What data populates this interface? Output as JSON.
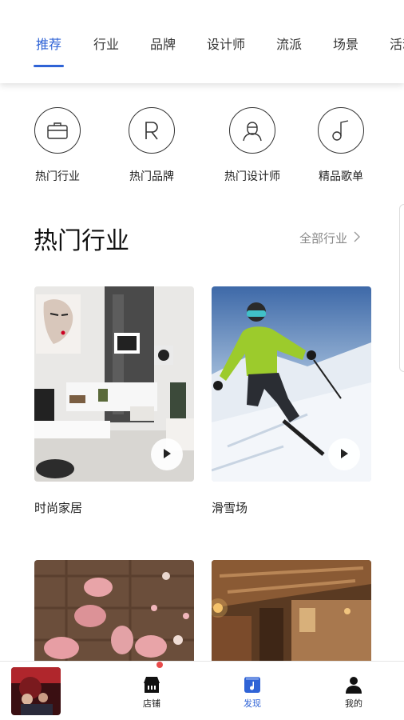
{
  "tabs": [
    {
      "label": "推荐",
      "active": true
    },
    {
      "label": "行业",
      "active": false
    },
    {
      "label": "品牌",
      "active": false
    },
    {
      "label": "设计师",
      "active": false
    },
    {
      "label": "流派",
      "active": false
    },
    {
      "label": "场景",
      "active": false
    },
    {
      "label": "活动",
      "active": false
    }
  ],
  "categories": [
    {
      "label": "热门行业",
      "icon": "briefcase-icon"
    },
    {
      "label": "热门品牌",
      "icon": "brand-r-icon"
    },
    {
      "label": "热门设计师",
      "icon": "designer-icon"
    },
    {
      "label": "精品歌单",
      "icon": "music-note-icon"
    }
  ],
  "section": {
    "title": "热门行业",
    "more_label": "全部行业"
  },
  "cards": [
    {
      "title": "时尚家居",
      "image": "living-room-photo",
      "has_play": true
    },
    {
      "title": "滑雪场",
      "image": "skier-photo",
      "has_play": true
    },
    {
      "title": "",
      "image": "pastry-photo",
      "has_play": false
    },
    {
      "title": "",
      "image": "cabin-interior-photo",
      "has_play": false
    }
  ],
  "bottom_nav": {
    "items": [
      {
        "label": "店铺",
        "icon": "store-icon",
        "active": false,
        "badge": true
      },
      {
        "label": "发现",
        "icon": "discover-music-icon",
        "active": true,
        "badge": false
      },
      {
        "label": "我的",
        "icon": "user-icon",
        "active": false,
        "badge": false
      }
    ]
  },
  "colors": {
    "accent": "#2f63d6",
    "badge": "#e84a4a"
  }
}
